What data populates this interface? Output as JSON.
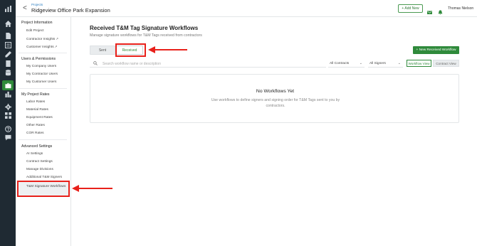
{
  "header": {
    "back_glyph": "<",
    "breadcrumb": "Projects",
    "project_title": "Ridgeview Office Park Expansion",
    "add_new_label": "+ Add New",
    "user_name": "Thomas Nielson"
  },
  "rail": {
    "icons": [
      "analytics-icon",
      "home-icon",
      "document-icon",
      "list-icon",
      "pen-icon",
      "file-icon",
      "database-icon",
      "briefcase-icon",
      "chart-icon",
      "gear-icon",
      "grid-icon",
      "help-icon",
      "chat-icon"
    ]
  },
  "sidebar": {
    "sections": [
      {
        "title": "Project Information",
        "items": [
          "Edit Project",
          "Contractor Insights",
          "Customer Insights"
        ]
      },
      {
        "title": "Users & Permissions",
        "items": [
          "My Company Users",
          "My Contractor Users",
          "My Customer Users"
        ]
      },
      {
        "title": "My Project Rates",
        "items": [
          "Labor Rates",
          "Material Rates",
          "Equipment Rates",
          "Other Rates",
          "COR Rates"
        ]
      },
      {
        "title": "Advanced Settings",
        "items": [
          "AI Settings",
          "Contract Settings",
          "Manage Divisions",
          "Additional T&M Signers",
          "T&M Signature Workflows"
        ]
      }
    ]
  },
  "main": {
    "title": "Received T&M Tag Signature Workflows",
    "subtitle": "Manage signature workflows for T&M Tags received from contractors",
    "tabs": [
      "Sent",
      "Received"
    ],
    "active_tab": "Received",
    "new_button_label": "+ New Received Workflow",
    "search_placeholder": "Search workflow name or description",
    "filters": [
      "All Contracts",
      "All Signers"
    ],
    "view_toggle": [
      "Workflow View",
      "Contract View"
    ],
    "empty_title": "No Workflows Yet",
    "empty_text": "Use workflows to define signers and signing order for T&M Tags sent to you by contractors."
  },
  "colors": {
    "accent": "#2f8a3b",
    "rail_bg": "#1f2a33",
    "link": "#2f7fc1",
    "annotation": "#e8211b"
  }
}
